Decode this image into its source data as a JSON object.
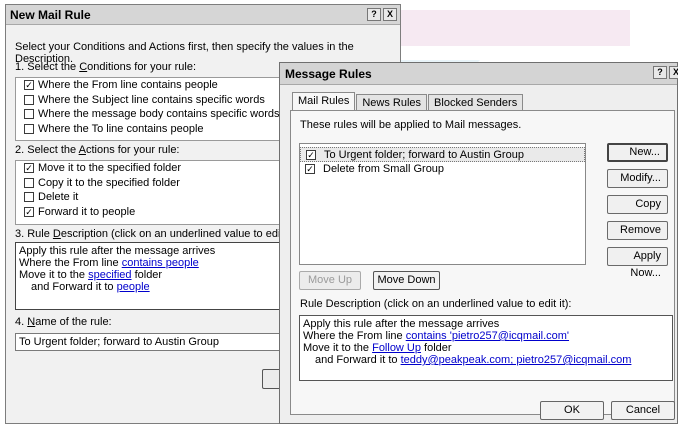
{
  "new_mail_rule": {
    "title": "New Mail Rule",
    "intro": "Select your Conditions and Actions first, then specify the values in the Description.",
    "conditions": {
      "label_prefix": "1. Select the ",
      "label_key": "C",
      "label_suffix": "onditions for your rule:",
      "items": [
        {
          "label": "Where the From line contains people",
          "checked": true
        },
        {
          "label": "Where the Subject line contains specific words",
          "checked": false
        },
        {
          "label": "Where the message body contains specific words",
          "checked": false
        },
        {
          "label": "Where the To line contains people",
          "checked": false
        }
      ]
    },
    "actions": {
      "label_prefix": "2. Select the ",
      "label_key": "A",
      "label_suffix": "ctions for your rule:",
      "items": [
        {
          "label": "Move it to the specified folder",
          "checked": true
        },
        {
          "label": "Copy it to the specified folder",
          "checked": false
        },
        {
          "label": "Delete it",
          "checked": false
        },
        {
          "label": "Forward it to people",
          "checked": true
        }
      ]
    },
    "description": {
      "label_prefix": "3. Rule ",
      "label_key": "D",
      "label_suffix": "escription (click on an underlined value to edit it):",
      "line1": "Apply this rule after the message arrives",
      "line2_text": "Where the From line ",
      "line2_link": "contains people",
      "line3_text": "Move it to the ",
      "line3_link": "specified",
      "line3_tail": " folder",
      "line4_text": "and Forward it to ",
      "line4_link": "people"
    },
    "name": {
      "label_prefix": "4. ",
      "label_key": "N",
      "label_suffix": "ame of the rule:",
      "value": "To Urgent folder; forward to Austin Group"
    }
  },
  "message_rules": {
    "title": "Message Rules",
    "tabs": [
      "Mail Rules",
      "News Rules",
      "Blocked Senders"
    ],
    "note": "These rules will be applied to Mail messages.",
    "rules": [
      {
        "label": "To Urgent folder; forward to Austin Group",
        "checked": true
      },
      {
        "label": "Delete from Small Group",
        "checked": true
      }
    ],
    "buttons": {
      "new": "New...",
      "modify": "Modify...",
      "copy": "Copy",
      "remove": "Remove",
      "apply_now": "Apply Now..."
    },
    "move_up": "Move Up",
    "move_down": "Move Down",
    "description": {
      "label": "Rule Description (click on an underlined value to edit it):",
      "line1": "Apply this rule after the message arrives",
      "line2_text": "Where the From line ",
      "line2_link": "contains 'pietro257@icqmail.com'",
      "line3_text": "Move it to the ",
      "line3_link": "Follow Up",
      "line3_tail": " folder",
      "line4_text": "and Forward it to ",
      "line4_link": "teddy@peakpeak.com; pietro257@icqmail.com"
    },
    "ok": "OK",
    "cancel": "Cancel"
  },
  "title_buttons": {
    "help": "?",
    "close": "X"
  }
}
